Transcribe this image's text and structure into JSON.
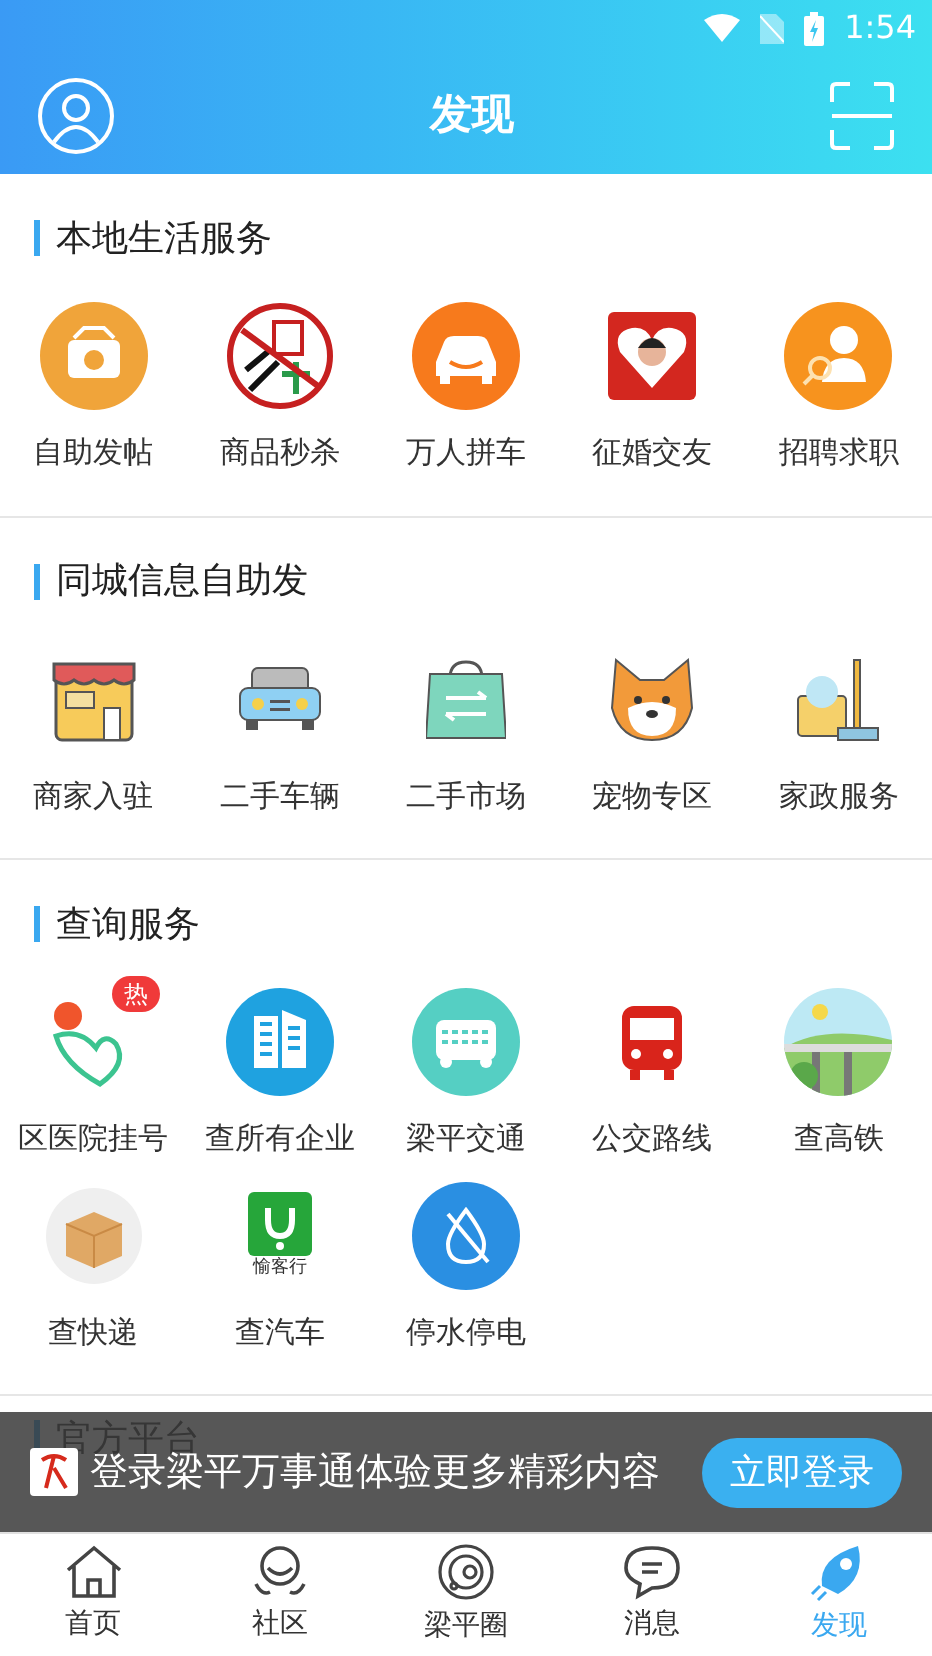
{
  "status_bar": {
    "time": "1:54"
  },
  "header": {
    "title": "发现"
  },
  "sections": [
    {
      "title": "本地生活服务",
      "items": [
        {
          "label": "自助发帖"
        },
        {
          "label": "商品秒杀"
        },
        {
          "label": "万人拼车"
        },
        {
          "label": "征婚交友"
        },
        {
          "label": "招聘求职"
        }
      ]
    },
    {
      "title": "同城信息自助发",
      "items": [
        {
          "label": "商家入驻"
        },
        {
          "label": "二手车辆"
        },
        {
          "label": "二手市场"
        },
        {
          "label": "宠物专区"
        },
        {
          "label": "家政服务"
        }
      ]
    },
    {
      "title": "查询服务",
      "items": [
        {
          "label": "区医院挂号",
          "badge": "热"
        },
        {
          "label": "查所有企业"
        },
        {
          "label": "梁平交通"
        },
        {
          "label": "公交路线"
        },
        {
          "label": "查高铁"
        },
        {
          "label": "查快递"
        },
        {
          "label": "查汽车",
          "icon_text": "愉客行"
        },
        {
          "label": "停水停电"
        }
      ]
    },
    {
      "title": "官方平台"
    }
  ],
  "login_banner": {
    "message": "登录梁平万事通体验更多精彩内容",
    "button": "立即登录"
  },
  "bottom_nav": [
    {
      "label": "首页",
      "selected": false
    },
    {
      "label": "社区",
      "selected": false
    },
    {
      "label": "梁平圈",
      "selected": false
    },
    {
      "label": "消息",
      "selected": false
    },
    {
      "label": "发现",
      "selected": true
    }
  ]
}
